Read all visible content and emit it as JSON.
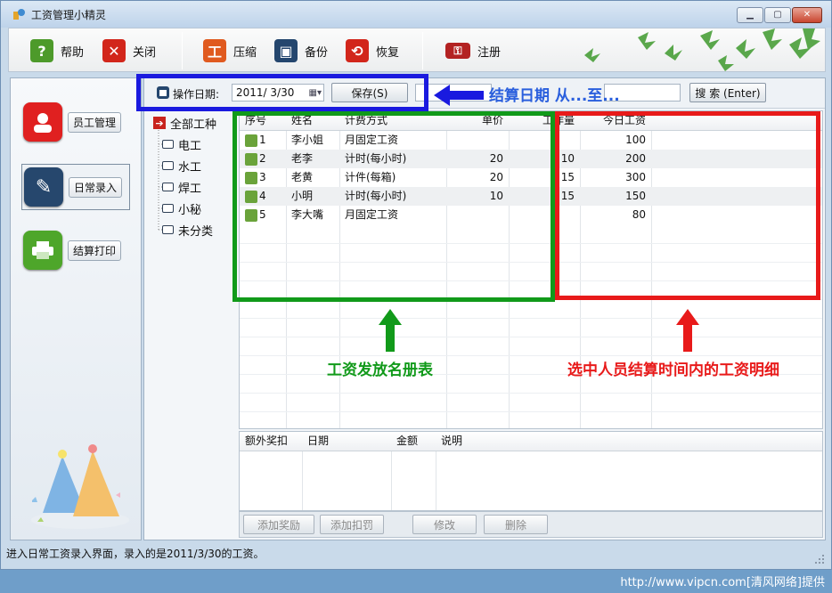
{
  "window": {
    "title": "工资管理小精灵"
  },
  "toolbar": {
    "help": "帮助",
    "close": "关闭",
    "compress": "压缩",
    "backup": "备份",
    "restore": "恢复",
    "register": "注册"
  },
  "nav": {
    "employee": "员工管理",
    "daily": "日常录入",
    "print": "结算打印"
  },
  "options": {
    "date_label": "操作日期:",
    "date_value": "2011/ 3/30",
    "save": "保存(S)",
    "search": "搜 索 (Enter)"
  },
  "tree": {
    "root": "全部工种",
    "children": [
      "电工",
      "水工",
      "焊工",
      "小秘",
      "未分类"
    ]
  },
  "grid": {
    "headers": [
      "序号",
      "姓名",
      "计费方式",
      "单价",
      "工作量",
      "今日工资"
    ],
    "rows": [
      {
        "no": "1",
        "name": "李小姐",
        "method": "月固定工资",
        "price": "",
        "qty": "",
        "wage": "100"
      },
      {
        "no": "2",
        "name": "老李",
        "method": "计时(每小时)",
        "price": "20",
        "qty": "10",
        "wage": "200"
      },
      {
        "no": "3",
        "name": "老黄",
        "method": "计件(每箱)",
        "price": "20",
        "qty": "15",
        "wage": "300"
      },
      {
        "no": "4",
        "name": "小明",
        "method": "计时(每小时)",
        "price": "10",
        "qty": "15",
        "wage": "150"
      },
      {
        "no": "5",
        "name": "李大嘴",
        "method": "月固定工资",
        "price": "",
        "qty": "",
        "wage": "80"
      }
    ]
  },
  "bottom_grid": {
    "headers": [
      "额外奖扣",
      "日期",
      "金额",
      "说明"
    ]
  },
  "bottom_buttons": {
    "add_bonus": "添加奖励",
    "add_penalty": "添加扣罚",
    "edit": "修改",
    "delete": "删除"
  },
  "annotations": {
    "date_range": "结算日期  从...至...",
    "roster": "工资发放名册表",
    "detail": "选中人员结算时间内的工资明细"
  },
  "status": {
    "text": "进入日常工资录入界面，录入的是2011/3/30的工资。"
  },
  "footer": {
    "watermark": "http://www.vipcn.com[清风网络]提供"
  },
  "colors": {
    "blue_box": "#1a1adf",
    "green_box": "#119a1a",
    "red_box": "#e81a1a"
  }
}
